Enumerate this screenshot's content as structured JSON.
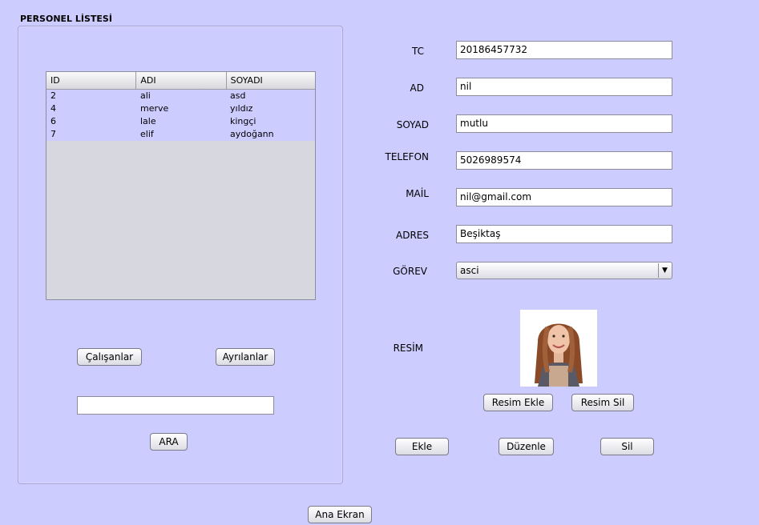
{
  "left_panel": {
    "title": "PERSONEL LİSTESİ",
    "table": {
      "headers": [
        "ID",
        "ADI",
        "SOYADI"
      ],
      "rows": [
        [
          "2",
          "ali",
          "asd"
        ],
        [
          "4",
          "merve",
          "yıldız"
        ],
        [
          "6",
          "lale",
          "kingçi"
        ],
        [
          "7",
          "elif",
          "aydoğann"
        ]
      ]
    },
    "buttons": {
      "calisanlar": "Çalışanlar",
      "ayrilanlar": "Ayrılanlar",
      "ara": "ARA"
    },
    "search_value": ""
  },
  "form": {
    "tc_label": "TC",
    "tc_value": "20186457732",
    "ad_label": "AD",
    "ad_value": "nil",
    "soyad_label": "SOYAD",
    "soyad_value": "mutlu",
    "telefon_label": "TELEFON",
    "telefon_value": "5026989574",
    "mail_label": "MAİL",
    "mail_value": "nil@gmail.com",
    "adres_label": "ADRES",
    "adres_value": "Beşiktaş",
    "gorev_label": "GÖREV",
    "gorev_value": "asci",
    "resim_label": "RESİM"
  },
  "photo_buttons": {
    "resim_ekle": "Resim Ekle",
    "resim_sil": "Resim Sil"
  },
  "actions": {
    "ekle": "Ekle",
    "duzenle": "Düzenle",
    "sil": "Sil"
  },
  "footer": {
    "ana_ekran": "Ana Ekran"
  },
  "colors": {
    "background": "#ccccff",
    "table_empty": "#d7d8df"
  }
}
